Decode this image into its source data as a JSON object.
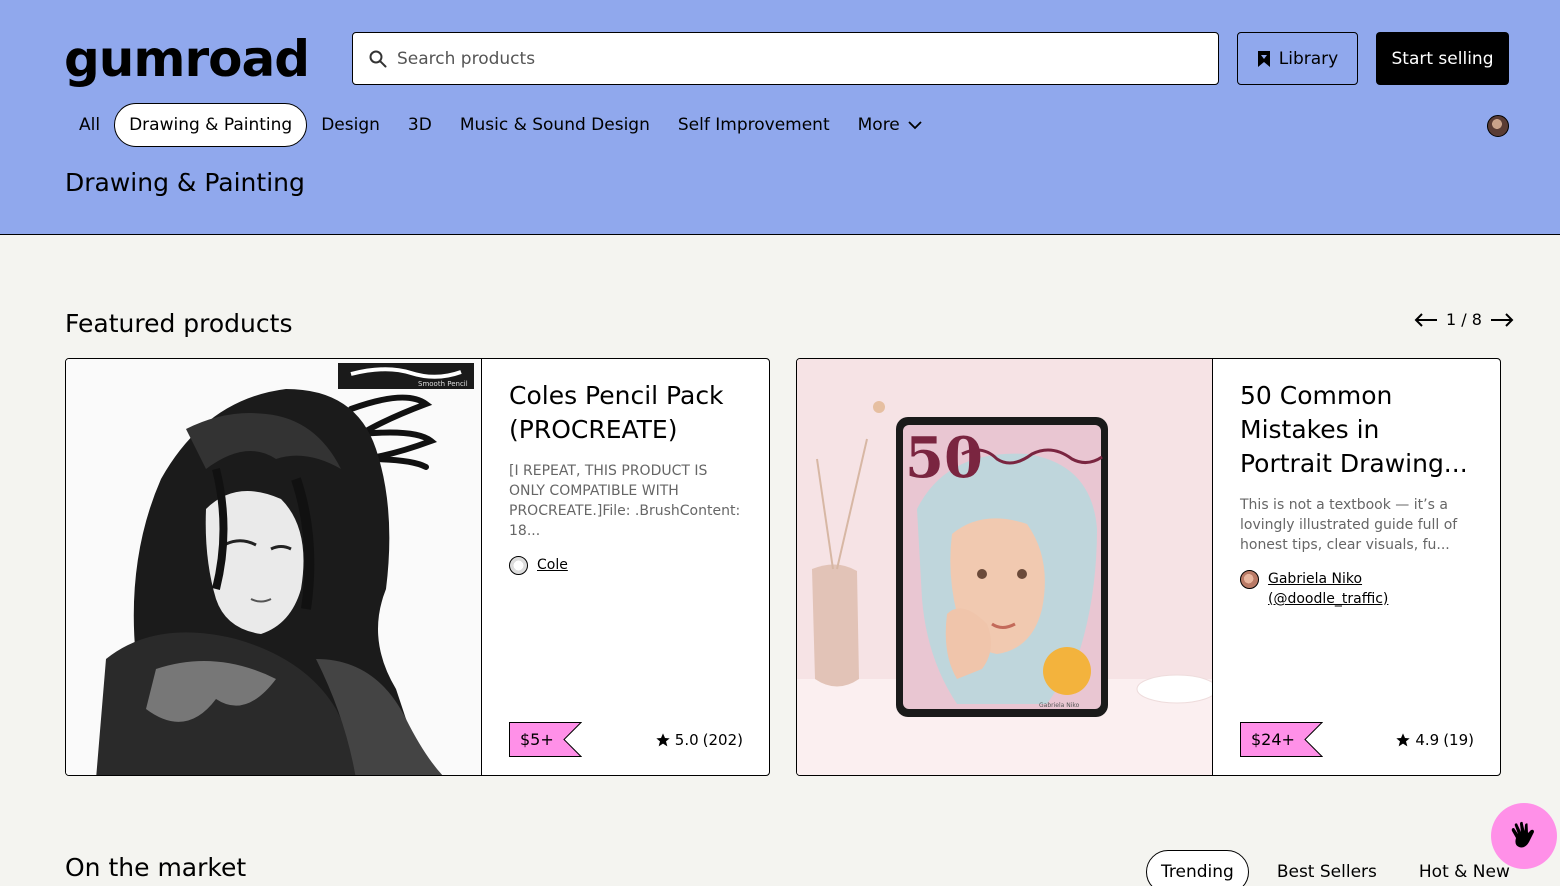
{
  "brand": {
    "logo_text": "GUMROAD"
  },
  "search": {
    "placeholder": "Search products"
  },
  "header_actions": {
    "library_label": "Library",
    "start_selling_label": "Start selling"
  },
  "nav": {
    "items": [
      {
        "label": "All",
        "active": false
      },
      {
        "label": "Drawing & Painting",
        "active": true
      },
      {
        "label": "Design",
        "active": false
      },
      {
        "label": "3D",
        "active": false
      },
      {
        "label": "Music & Sound Design",
        "active": false
      },
      {
        "label": "Self Improvement",
        "active": false
      },
      {
        "label": "More",
        "active": false
      }
    ]
  },
  "page": {
    "title": "Drawing & Painting"
  },
  "featured": {
    "title": "Featured products",
    "pager": "1 / 8",
    "products": [
      {
        "title": "Coles Pencil Pack (PROCREATE)",
        "description": "[I REPEAT, THIS PRODUCT IS ONLY COMPATIBLE WITH PROCREATE.]File: .BrushContent: 18...",
        "creator": "Cole",
        "price": "$5+",
        "rating": "5.0",
        "rating_count": "(202)",
        "image_label": "Smooth Pencil"
      },
      {
        "title": "50 Common Mistakes in Portrait Drawing...",
        "description": "This is not a textbook — it’s a lovingly illustrated guide full of honest tips, clear visuals, fu...",
        "creator": "Gabriela Niko (@doodle_traffic)",
        "price": "$24+",
        "rating": "4.9",
        "rating_count": "(19)",
        "image_label": "Gabriela Niko"
      }
    ]
  },
  "market": {
    "title": "On the market",
    "tabs": [
      {
        "label": "Trending",
        "active": true
      },
      {
        "label": "Best Sellers",
        "active": false
      },
      {
        "label": "Hot & New",
        "active": false
      }
    ]
  },
  "colors": {
    "header_bg": "#90a8ed",
    "accent_pink": "#ff90e8",
    "page_bg": "#f4f4f0"
  }
}
